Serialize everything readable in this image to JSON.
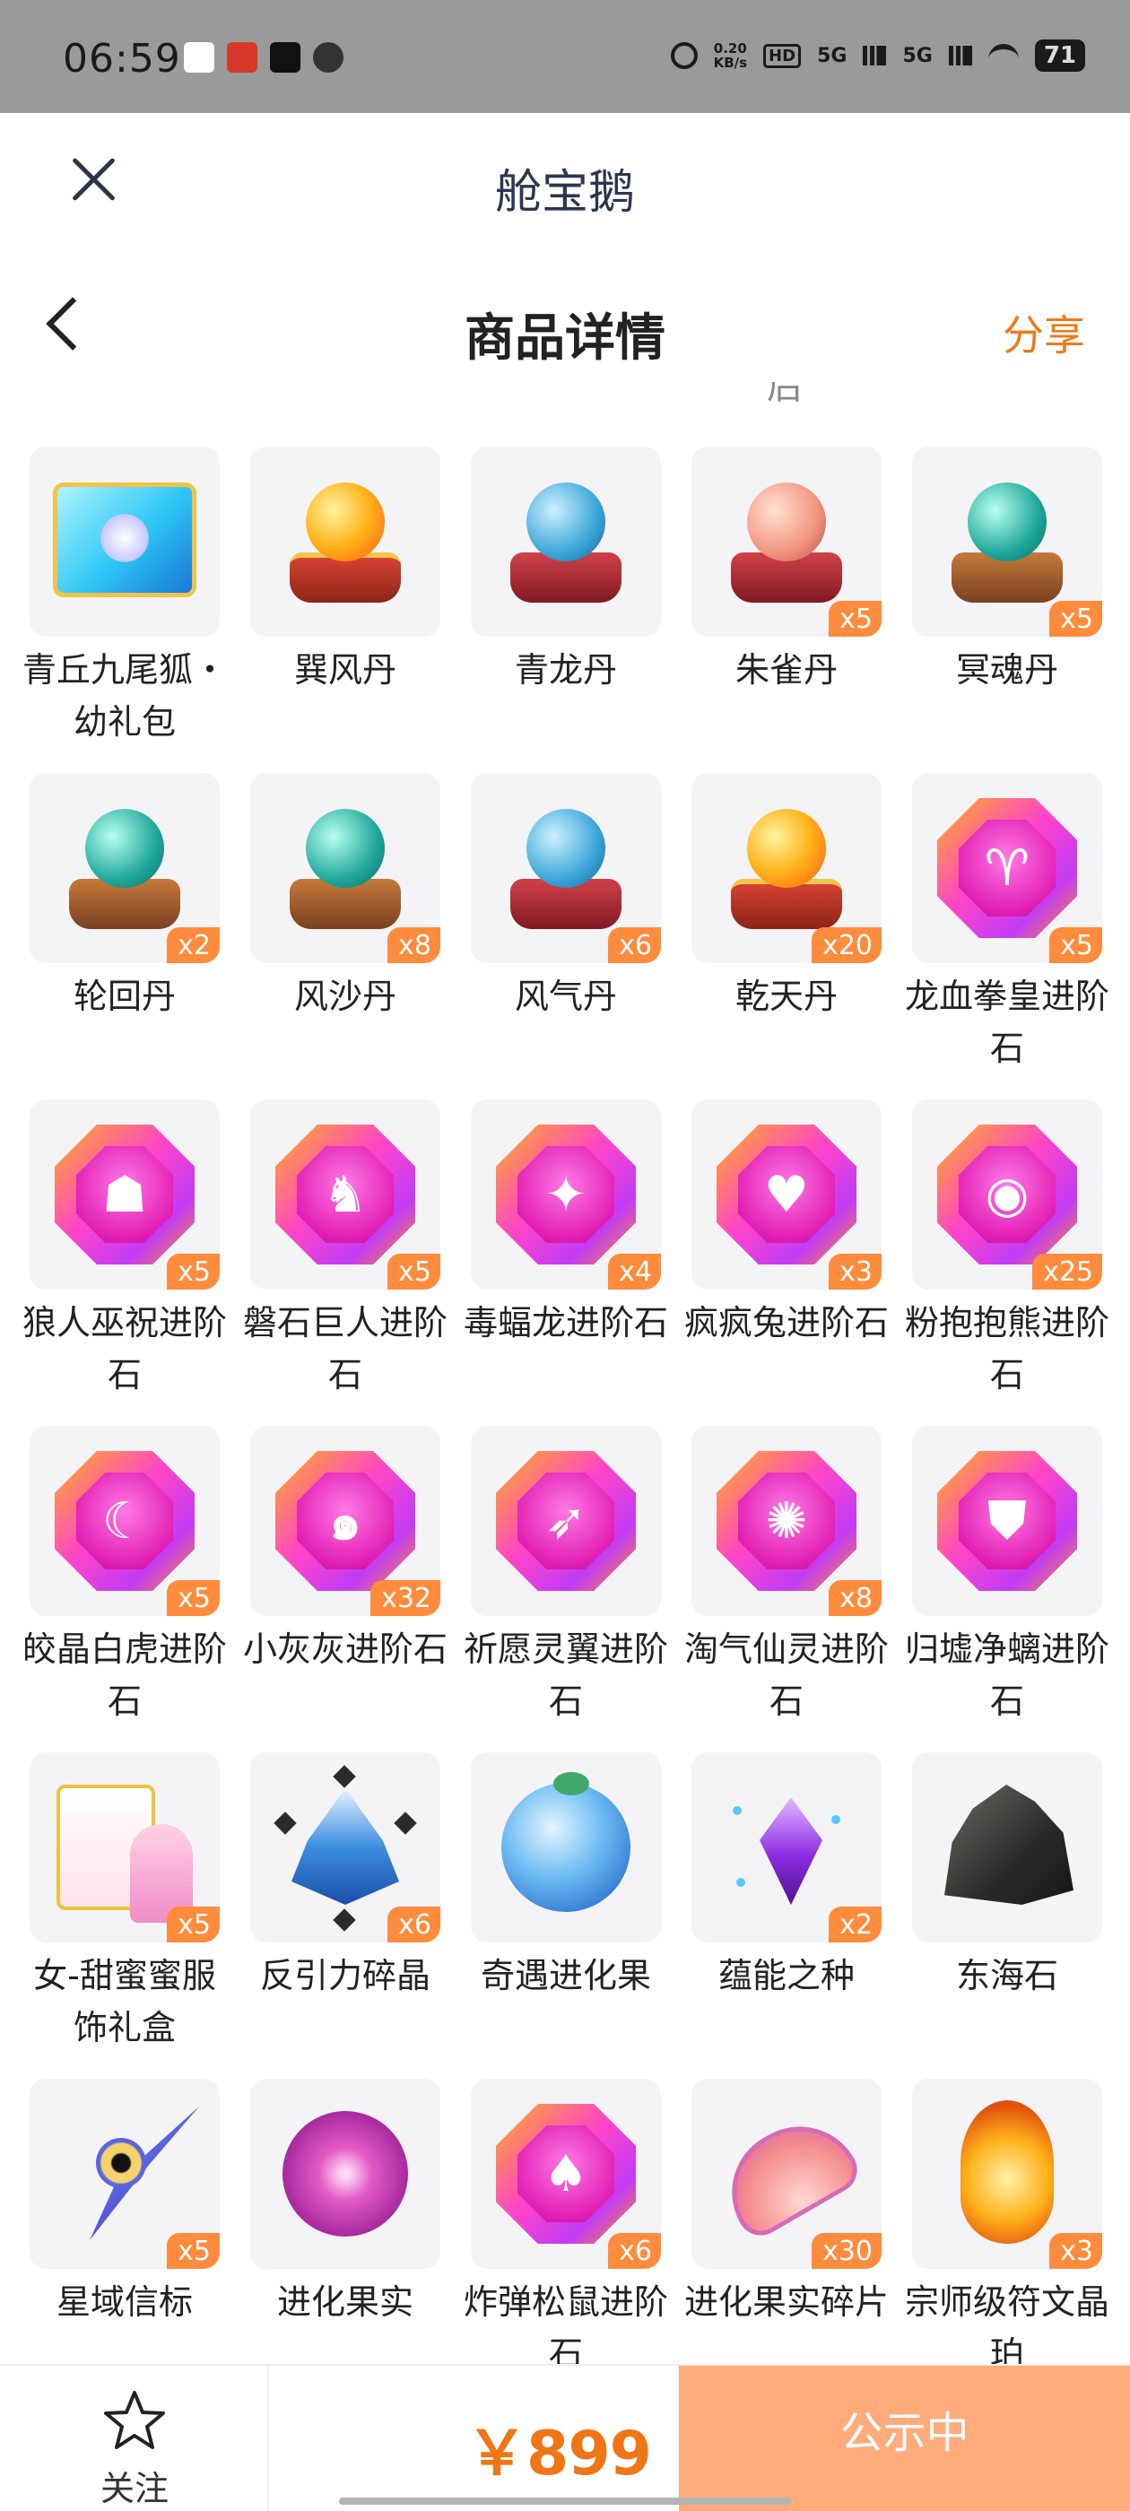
{
  "status_bar": {
    "time": "06:59",
    "net_speed_value": "0.20",
    "net_speed_unit": "KB/s",
    "hd_label": "HD",
    "signal1": "5G",
    "signal2": "5G",
    "battery": "71"
  },
  "app_header": {
    "title": "舱宝鹅"
  },
  "page_header": {
    "title": "商品详情",
    "share_label": "分享"
  },
  "top_cut_text": "后",
  "items": [
    {
      "name": "青丘九尾狐・幼礼包",
      "qty": "",
      "icon": "gift-pack-icon"
    },
    {
      "name": "巽风丹",
      "qty": "",
      "icon": "fire-orb-icon"
    },
    {
      "name": "青龙丹",
      "qty": "",
      "icon": "blue-orb-icon"
    },
    {
      "name": "朱雀丹",
      "qty": "x5",
      "icon": "pink-orb-icon"
    },
    {
      "name": "冥魂丹",
      "qty": "x5",
      "icon": "teal-orb-icon"
    },
    {
      "name": "轮回丹",
      "qty": "x2",
      "icon": "teal-orb-icon"
    },
    {
      "name": "风沙丹",
      "qty": "x8",
      "icon": "teal-orb-icon"
    },
    {
      "name": "风气丹",
      "qty": "x6",
      "icon": "blue-orb-icon"
    },
    {
      "name": "乾天丹",
      "qty": "x20",
      "icon": "fire-orb-icon"
    },
    {
      "name": "龙血拳皇进阶石",
      "qty": "x5",
      "icon": "evolution-gem-icon"
    },
    {
      "name": "狼人巫祝进阶石",
      "qty": "x5",
      "icon": "evolution-gem-icon"
    },
    {
      "name": "磐石巨人进阶石",
      "qty": "x5",
      "icon": "evolution-gem-icon"
    },
    {
      "name": "毒蝠龙进阶石",
      "qty": "x4",
      "icon": "evolution-gem-icon"
    },
    {
      "name": "疯疯兔进阶石",
      "qty": "x3",
      "icon": "evolution-gem-icon"
    },
    {
      "name": "粉抱抱熊进阶石",
      "qty": "x25",
      "icon": "evolution-gem-icon"
    },
    {
      "name": "皎晶白虎进阶石",
      "qty": "x5",
      "icon": "evolution-gem-icon"
    },
    {
      "name": "小灰灰进阶石",
      "qty": "x32",
      "icon": "evolution-gem-icon"
    },
    {
      "name": "祈愿灵翼进阶石",
      "qty": "",
      "icon": "evolution-gem-icon"
    },
    {
      "name": "淘气仙灵进阶石",
      "qty": "x8",
      "icon": "evolution-gem-icon"
    },
    {
      "name": "归墟净螭进阶石",
      "qty": "",
      "icon": "evolution-gem-icon"
    },
    {
      "name": "女-甜蜜蜜服饰礼盒",
      "qty": "x5",
      "icon": "gift-box-icon"
    },
    {
      "name": "反引力碎晶",
      "qty": "x6",
      "icon": "crystal-shard-icon"
    },
    {
      "name": "奇遇进化果",
      "qty": "",
      "icon": "blue-fruit-icon"
    },
    {
      "name": "蕴能之种",
      "qty": "x2",
      "icon": "purple-crystal-icon"
    },
    {
      "name": "东海石",
      "qty": "",
      "icon": "rock-icon"
    },
    {
      "name": "星域信标",
      "qty": "x5",
      "icon": "star-beacon-icon"
    },
    {
      "name": "进化果实",
      "qty": "",
      "icon": "berry-icon"
    },
    {
      "name": "炸弹松鼠进阶石",
      "qty": "x6",
      "icon": "evolution-gem-icon"
    },
    {
      "name": "进化果实碎片",
      "qty": "x30",
      "icon": "fruit-fragment-icon"
    },
    {
      "name": "宗师级符文晶珀",
      "qty": "x3",
      "icon": "amber-egg-icon"
    }
  ],
  "bottom_bar": {
    "follow_label": "关注",
    "price": "￥899",
    "status_button_label": "公示中"
  },
  "colors": {
    "accent_orange": "#f07a18",
    "qty_badge": "#ff8b3d",
    "status_button": "#ffab7c"
  }
}
